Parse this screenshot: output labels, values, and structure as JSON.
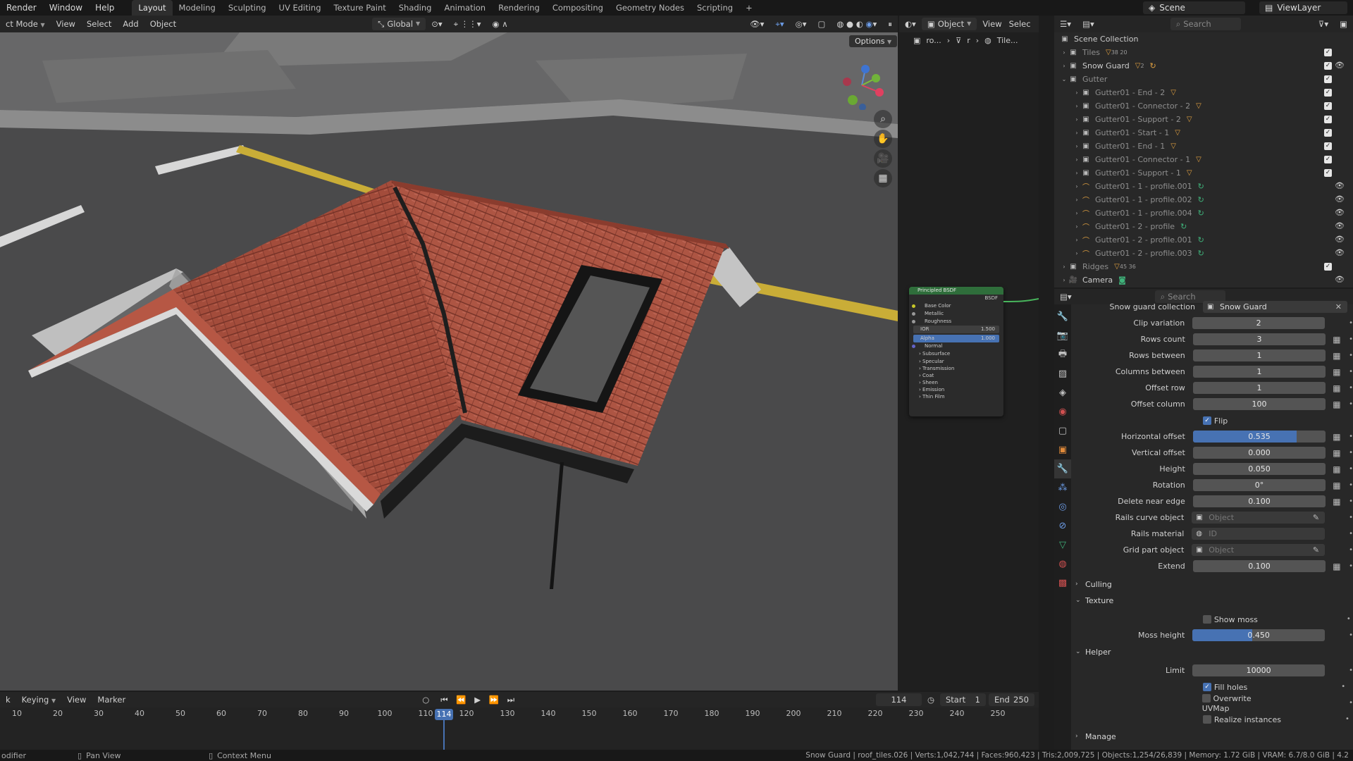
{
  "topbar": {
    "menus": [
      "Render",
      "Window",
      "Help"
    ],
    "workspaces": [
      "Layout",
      "Modeling",
      "Sculpting",
      "UV Editing",
      "Texture Paint",
      "Shading",
      "Animation",
      "Rendering",
      "Compositing",
      "Geometry Nodes",
      "Scripting"
    ],
    "add_tab": "+",
    "scene": "Scene",
    "view_layer": "ViewLayer"
  },
  "viewport_header": {
    "mode": "ct Mode",
    "menus": [
      "View",
      "Select",
      "Add",
      "Object"
    ],
    "orientation": "Global",
    "options": "Options"
  },
  "node_header": {
    "object": "Object",
    "menus": [
      "View",
      "Selec"
    ],
    "breadcrumb": [
      "ro...",
      "r",
      "Tile..."
    ]
  },
  "node": {
    "title": "Principled BSDF",
    "output": "BSDF",
    "rows": [
      "Base Color",
      "Metallic",
      "Roughness"
    ],
    "ior_label": "IOR",
    "ior_value": "1.500",
    "alpha_label": "Alpha",
    "alpha_value": "1.000",
    "normal": "Normal",
    "sub": [
      "Subsurface",
      "Specular",
      "Transmission",
      "Coat",
      "Sheen",
      "Emission",
      "Thin Film"
    ]
  },
  "outliner": {
    "search_placeholder": "Search",
    "root": "Scene Collection",
    "tiles": "Tiles",
    "tiles_count": "38 20",
    "snow_guard": "Snow Guard",
    "snow_guard_count": "2",
    "gutter": "Gutter",
    "gutter_items": [
      "Gutter01 - End - 2",
      "Gutter01 - Connector - 2",
      "Gutter01 - Support - 2",
      "Gutter01 - Start - 1",
      "Gutter01 - End - 1",
      "Gutter01 - Connector - 1",
      "Gutter01 - Support - 1"
    ],
    "profiles": [
      "Gutter01 - 1 - profile.001",
      "Gutter01 - 1 - profile.002",
      "Gutter01 - 1 - profile.004",
      "Gutter01 - 2 - profile",
      "Gutter01 - 2 - profile.001",
      "Gutter01 - 2 - profile.003"
    ],
    "ridges": "Ridges",
    "ridges_count": "45 36",
    "camera": "Camera"
  },
  "properties": {
    "search_placeholder": "Search",
    "collection_label": "Snow guard collection",
    "collection_value": "Snow Guard",
    "clip_variation_label": "Clip variation",
    "clip_variation": "2",
    "rows_count_label": "Rows count",
    "rows_count": "3",
    "rows_between_label": "Rows between",
    "rows_between": "1",
    "columns_between_label": "Columns between",
    "columns_between": "1",
    "offset_row_label": "Offset row",
    "offset_row": "1",
    "offset_column_label": "Offset column",
    "offset_column": "100",
    "flip_label": "Flip",
    "horizontal_offset_label": "Horizontal offset",
    "horizontal_offset": "0.535",
    "horizontal_offset_fill": 0.78,
    "vertical_offset_label": "Vertical offset",
    "vertical_offset": "0.000",
    "height_label": "Height",
    "height": "0.050",
    "rotation_label": "Rotation",
    "rotation": "0°",
    "delete_near_edge_label": "Delete near edge",
    "delete_near_edge": "0.100",
    "rails_curve_label": "Rails curve object",
    "rails_curve_placeholder": "Object",
    "rails_material_label": "Rails material",
    "rails_material_placeholder": "ID",
    "grid_part_label": "Grid part object",
    "grid_part_placeholder": "Object",
    "extend_label": "Extend",
    "extend": "0.100",
    "culling": "Culling",
    "texture": "Texture",
    "show_moss_label": "Show moss",
    "moss_height_label": "Moss height",
    "moss_height": "0.450",
    "moss_height_fill": 0.45,
    "helper": "Helper",
    "limit_label": "Limit",
    "limit": "10000",
    "fill_holes_label": "Fill holes",
    "overwrite_uvmap_label": "Overwrite UVMap",
    "realize_instances_label": "Realize instances",
    "manage": "Manage"
  },
  "timeline": {
    "menus": [
      "k",
      "Keying",
      "View",
      "Marker"
    ],
    "current_frame": "114",
    "start_label": "Start",
    "start": "1",
    "end_label": "End",
    "end": "250",
    "ticks": [
      "10",
      "20",
      "30",
      "40",
      "50",
      "60",
      "70",
      "80",
      "90",
      "100",
      "110",
      "120",
      "130",
      "140",
      "150",
      "160",
      "170",
      "180",
      "190",
      "200",
      "210",
      "220",
      "230",
      "240",
      "250"
    ]
  },
  "statusbar": {
    "left": "odifier",
    "pan": "Pan View",
    "context": "Context Menu",
    "stats": "Snow Guard | roof_tiles.026 | Verts:1,042,744 | Faces:960,423 | Tris:2,009,725 | Objects:1,254/26,839 | Memory: 1.72 GiB | VRAM: 6.7/8.0 GiB | 4.2"
  },
  "colors": {
    "accent": "#4772b3",
    "tiles": "#a9503f",
    "node_header": "#2f6e3b"
  }
}
